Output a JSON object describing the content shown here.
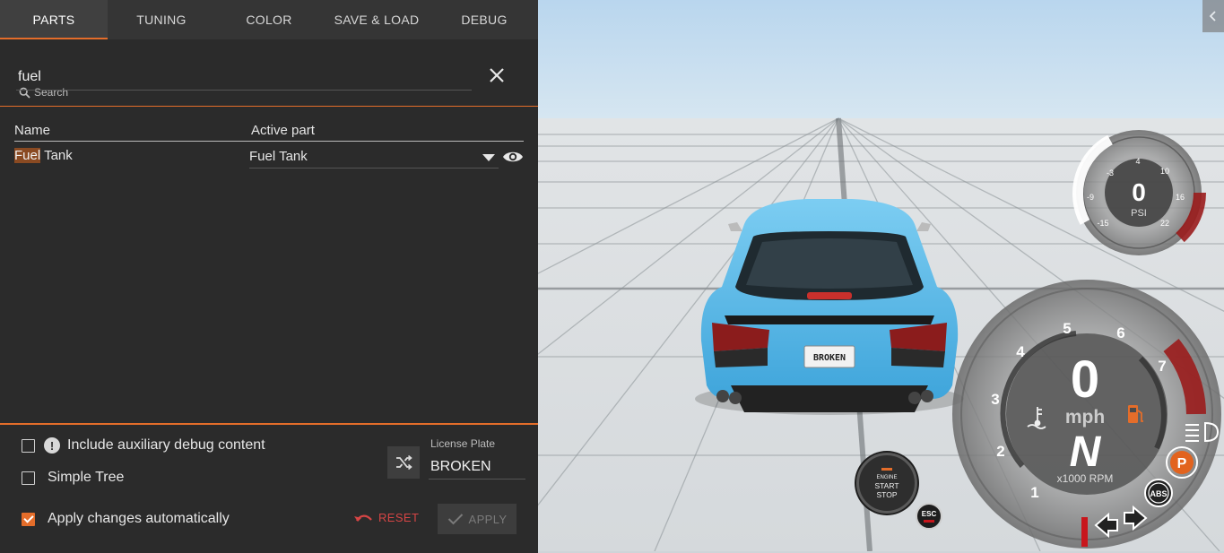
{
  "tabs": [
    {
      "label": "PARTS",
      "active": true
    },
    {
      "label": "TUNING",
      "active": false
    },
    {
      "label": "COLOR",
      "active": false
    },
    {
      "label": "SAVE & LOAD",
      "active": false
    },
    {
      "label": "DEBUG",
      "active": false
    }
  ],
  "search": {
    "label": "Search",
    "value": "fuel",
    "icon": "search-icon"
  },
  "table": {
    "columns": [
      "Name",
      "Active part"
    ],
    "rows": [
      {
        "name_highlight": "Fuel",
        "name_rest": " Tank",
        "active_part": "Fuel Tank"
      }
    ]
  },
  "options": {
    "include_debug": {
      "label": "Include auxiliary debug content",
      "checked": false
    },
    "simple_tree": {
      "label": "Simple Tree",
      "checked": false
    },
    "apply_auto": {
      "label": "Apply changes automatically",
      "checked": true
    }
  },
  "license_plate": {
    "label": "License Plate",
    "value": "BROKEN"
  },
  "actions": {
    "reset_label": "RESET",
    "apply_label": "APPLY"
  },
  "colors": {
    "accent": "#e46d2a",
    "reset": "#d64545",
    "car": "#5bbbe6"
  },
  "hud": {
    "boost": {
      "value": "0",
      "unit": "PSI",
      "ticks": [
        "-15",
        "-9",
        "-3",
        "4",
        "10",
        "16",
        "22"
      ]
    },
    "speed": {
      "value": "0",
      "unit": "mph",
      "gear": "N",
      "rpm_unit": "x1000 RPM",
      "rpm_ticks": [
        "1",
        "2",
        "3",
        "4",
        "5",
        "6",
        "7"
      ]
    },
    "engine_button": {
      "line1": "ENGINE",
      "line2": "START",
      "line3": "STOP"
    },
    "esc_label": "ESC",
    "parking_label": "P",
    "abs_label": "ABS",
    "plate_text": "BROKEN"
  }
}
